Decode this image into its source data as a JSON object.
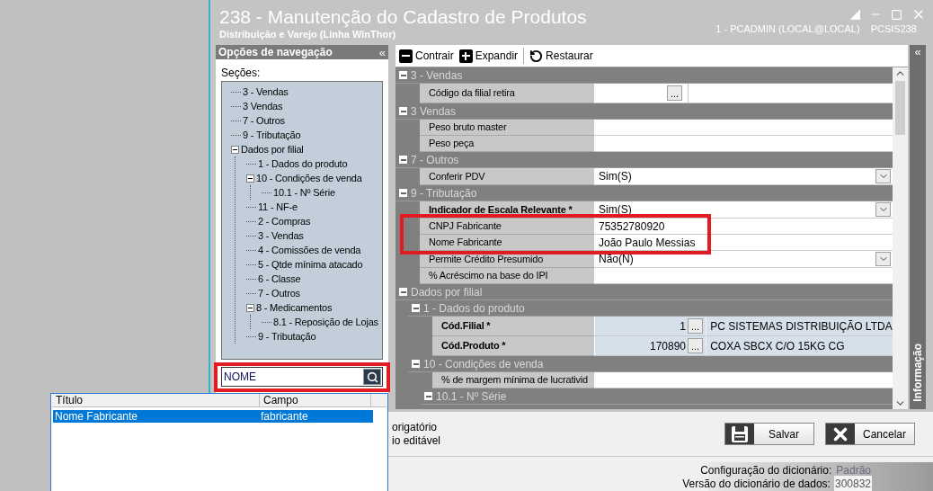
{
  "window": {
    "title": "238 - Manutenção do Cadastro de Produtos",
    "subtitle": "Distribuição e Varejo (Linha WinThor)",
    "user": "1 - PCADMIN (LOCAL@LOCAL)",
    "program": "PCSIS238"
  },
  "nav": {
    "title": "Opções de navegação",
    "collapse": "«",
    "group_label": "Seções:",
    "search": {
      "value": "NOME"
    },
    "tree": [
      {
        "label": "3 - Vendas"
      },
      {
        "label": "3 Vendas"
      },
      {
        "label": "7 - Outros"
      },
      {
        "label": "9 - Tributação"
      },
      {
        "label": "Dados por filial",
        "expanded": true,
        "children": [
          {
            "label": "1 - Dados do produto"
          },
          {
            "label": "10 - Condições de venda",
            "expanded": true,
            "children": [
              {
                "label": "10.1 - Nº Série"
              }
            ]
          },
          {
            "label": "11 - NF-e"
          },
          {
            "label": "2 - Compras"
          },
          {
            "label": "3 - Vendas"
          },
          {
            "label": "4 - Comissões de venda"
          },
          {
            "label": "5 - Qtde mínima atacado"
          },
          {
            "label": "6 - Classe"
          },
          {
            "label": "7 - Outros"
          },
          {
            "label": "8 - Medicamentos",
            "expanded": true,
            "children": [
              {
                "label": "8.1 -  Reposição de Lojas"
              }
            ]
          },
          {
            "label": "9 - Tributação"
          }
        ]
      }
    ]
  },
  "toolbar": [
    {
      "label": "Contrair",
      "kind": "collapse"
    },
    {
      "label": "Expandir",
      "kind": "expand"
    },
    {
      "label": "Restaurar",
      "kind": "restore"
    }
  ],
  "grid": {
    "sections": [
      {
        "kind": "section",
        "title": "3 - Vendas",
        "expanded": true,
        "children": [
          {
            "kind": "button",
            "label": "Código da filial retira",
            "button": "..."
          }
        ]
      },
      {
        "kind": "section",
        "title": "3 Vendas",
        "expanded": true,
        "children": [
          {
            "kind": "text",
            "label": "Peso bruto master"
          },
          {
            "kind": "text",
            "label": "Peso peça"
          }
        ]
      },
      {
        "kind": "section",
        "title": "7 - Outros",
        "expanded": true,
        "children": [
          {
            "kind": "dropdown",
            "label": "Conferir PDV",
            "value": "Sim(S)"
          }
        ]
      },
      {
        "kind": "section",
        "title": "9 - Tributação",
        "expanded": true,
        "children": [
          {
            "kind": "dropdown",
            "label": "Indicador de Escala Relevante *",
            "value": "Sim(S)",
            "required": true
          },
          {
            "kind": "text",
            "label": "CNPJ Fabricante",
            "value": "75352780920"
          },
          {
            "kind": "text",
            "label": "Nome Fabricante",
            "value": "João Paulo Messias"
          },
          {
            "kind": "dropdown",
            "label": "Permite Crédito Presumido",
            "value": "Não(N)"
          },
          {
            "kind": "text",
            "label": "% Acréscimo na base do IPI"
          }
        ]
      },
      {
        "kind": "section",
        "title": "Dados por filial",
        "expanded": true,
        "children": [
          {
            "kind": "section",
            "title": "1 - Dados do produto",
            "expanded": true,
            "children": [
              {
                "kind": "code",
                "label": "Cód.Filial *",
                "required": true,
                "code": "1",
                "button": "...",
                "description": "PC SISTEMAS DISTRIBUIÇÃO LTDA"
              },
              {
                "kind": "code",
                "label": "Cód.Produto *",
                "required": true,
                "code": "170890",
                "button": "...",
                "description": "COXA SBCX C/O 15KG CG"
              }
            ]
          },
          {
            "kind": "section",
            "title": "10 - Condições de venda",
            "expanded": true,
            "children": [
              {
                "kind": "text",
                "label": "% de margem mínima de lucrativid"
              },
              {
                "kind": "section",
                "title": "10.1 - Nº Série",
                "expanded": true
              }
            ]
          }
        ]
      }
    ]
  },
  "info_panel": {
    "collapse": "«",
    "title": "Informação"
  },
  "legend": [
    "origatório",
    "io editável"
  ],
  "buttons": [
    {
      "label": "Salvar",
      "kind": "save"
    },
    {
      "label": "Cancelar",
      "kind": "cancel"
    }
  ],
  "status_bar": [
    {
      "label": "Configuração do dicionário:",
      "value": "Padrão"
    },
    {
      "label": "Versão do dicionário de dados:",
      "value": "300832"
    }
  ],
  "results_popup": {
    "columns": [
      "Título",
      "Campo"
    ],
    "rows": [
      {
        "cells": [
          "Nome Fabricante",
          "fabricante"
        ],
        "selected": true
      }
    ]
  }
}
